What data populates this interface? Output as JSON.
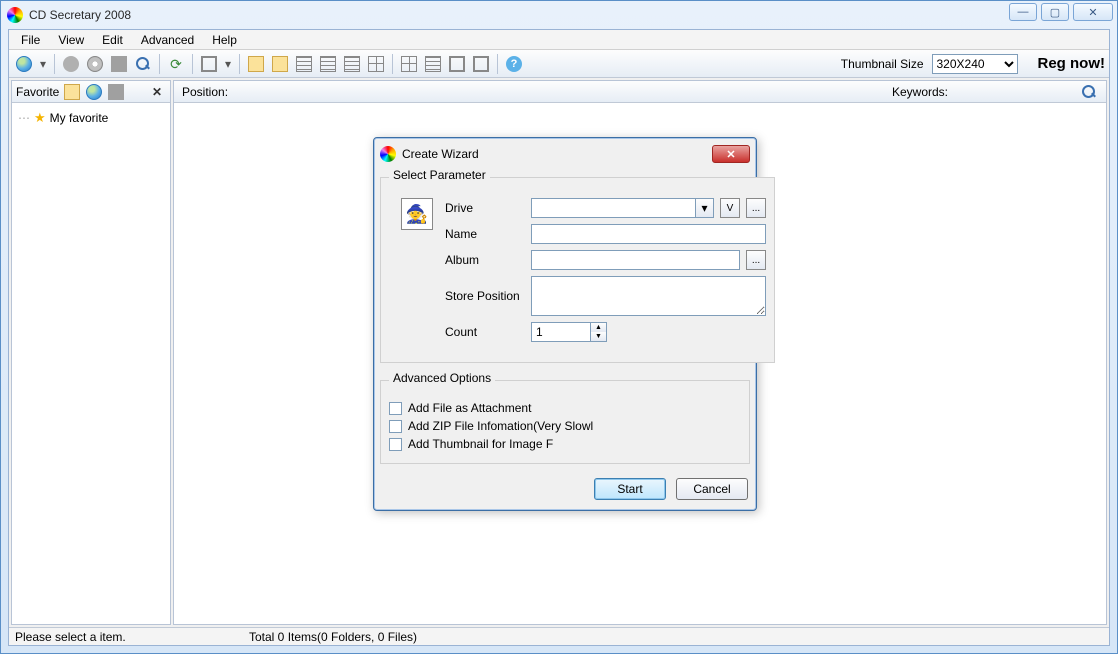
{
  "window": {
    "title": "CD Secretary 2008"
  },
  "menu": {
    "file": "File",
    "view": "View",
    "edit": "Edit",
    "advanced": "Advanced",
    "help": "Help"
  },
  "toolbar": {
    "thumbnail_label": "Thumbnail Size",
    "thumbnail_value": "320X240",
    "reg": "Reg now!"
  },
  "sidebar": {
    "title": "Favorite",
    "items": [
      {
        "label": "My favorite"
      }
    ]
  },
  "mainheader": {
    "position_label": "Position:",
    "keywords_label": "Keywords:"
  },
  "status": {
    "left": "Please select a item.",
    "right": "Total 0 Items(0 Folders, 0 Files)"
  },
  "dialog": {
    "title": "Create Wizard",
    "group_param": "Select Parameter",
    "labels": {
      "drive": "Drive",
      "name": "Name",
      "album": "Album",
      "store": "Store Position",
      "count": "Count"
    },
    "values": {
      "drive": "",
      "name": "",
      "album": "",
      "store": "",
      "count": "1"
    },
    "v_button": "V",
    "browse_button": "...",
    "group_adv": "Advanced Options",
    "checks": {
      "c1": "Add File as Attachment",
      "c2": "Add ZIP File Infomation(Very Slowl",
      "c3": "Add Thumbnail for Image F"
    },
    "start": "Start",
    "cancel": "Cancel"
  }
}
